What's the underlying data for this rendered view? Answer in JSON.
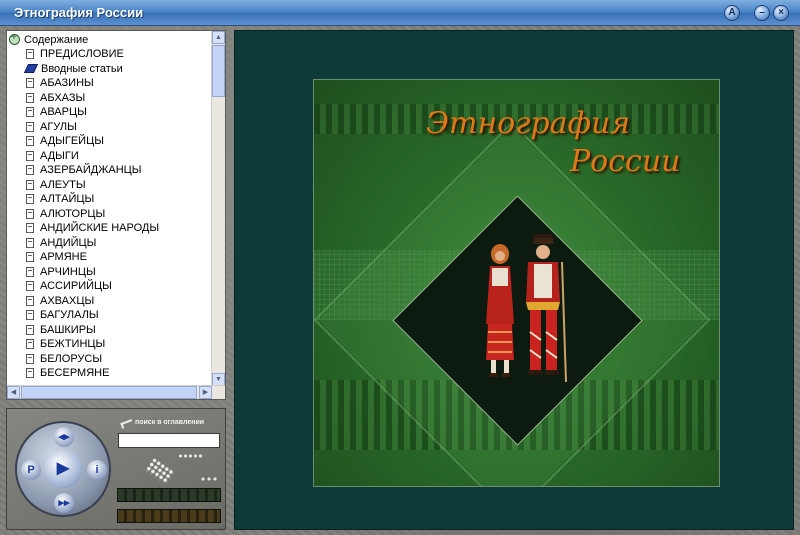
{
  "window": {
    "title": "Этнография России",
    "buttons": [
      "A",
      "–",
      "×"
    ]
  },
  "toc": {
    "root_label": "Содержание",
    "items": [
      {
        "label": "ПРЕДИСЛОВИЕ",
        "icon": "document-icon"
      },
      {
        "label": "Вводные статьи",
        "icon": "book-icon"
      },
      {
        "label": "АБАЗИНЫ",
        "icon": "document-icon"
      },
      {
        "label": "АБХАЗЫ",
        "icon": "document-icon"
      },
      {
        "label": "АВАРЦЫ",
        "icon": "document-icon"
      },
      {
        "label": "АГУЛЫ",
        "icon": "document-icon"
      },
      {
        "label": "АДЫГЕЙЦЫ",
        "icon": "document-icon"
      },
      {
        "label": "АДЫГИ",
        "icon": "document-icon"
      },
      {
        "label": "АЗЕРБАЙДЖАНЦЫ",
        "icon": "document-icon"
      },
      {
        "label": "АЛЕУТЫ",
        "icon": "document-icon"
      },
      {
        "label": "АЛТАЙЦЫ",
        "icon": "document-icon"
      },
      {
        "label": "АЛЮТОРЦЫ",
        "icon": "document-icon"
      },
      {
        "label": "АНДИЙСКИЕ НАРОДЫ",
        "icon": "document-icon"
      },
      {
        "label": "АНДИЙЦЫ",
        "icon": "document-icon"
      },
      {
        "label": "АРМЯНЕ",
        "icon": "document-icon"
      },
      {
        "label": "АРЧИНЦЫ",
        "icon": "document-icon"
      },
      {
        "label": "АССИРИЙЦЫ",
        "icon": "document-icon"
      },
      {
        "label": "АХВАХЦЫ",
        "icon": "document-icon"
      },
      {
        "label": "БАГУЛАЛЫ",
        "icon": "document-icon"
      },
      {
        "label": "БАШКИРЫ",
        "icon": "document-icon"
      },
      {
        "label": "БЕЖТИНЦЫ",
        "icon": "document-icon"
      },
      {
        "label": "БЕЛОРУСЫ",
        "icon": "document-icon"
      },
      {
        "label": "БЕСЕРМЯНЕ",
        "icon": "document-icon"
      }
    ]
  },
  "control": {
    "search_hint": "поиск в оглавлении",
    "search_value": "",
    "dial": {
      "top": "◂▸",
      "left": "P",
      "right": "i",
      "bottom": "▸▸",
      "center": "▶"
    }
  },
  "poster": {
    "title_line1": "Этнография",
    "title_line2": "России"
  }
}
